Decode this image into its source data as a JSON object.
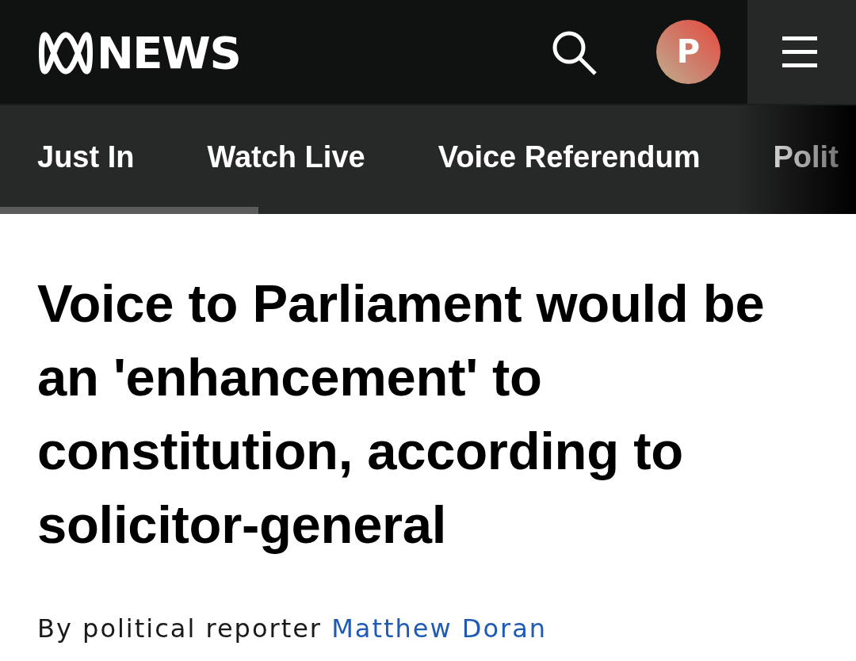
{
  "header": {
    "logo_text": "NEWS",
    "avatar_initial": "P"
  },
  "nav": {
    "items": [
      {
        "label": "Just In"
      },
      {
        "label": "Watch Live"
      },
      {
        "label": "Voice Referendum"
      },
      {
        "label": "Polit"
      }
    ]
  },
  "article": {
    "headline": "Voice to Parliament would be an 'enhancement' to constitution, according to solicitor-general",
    "byline": {
      "prefix": "By political reporter",
      "author": "Matthew Doran"
    }
  }
}
